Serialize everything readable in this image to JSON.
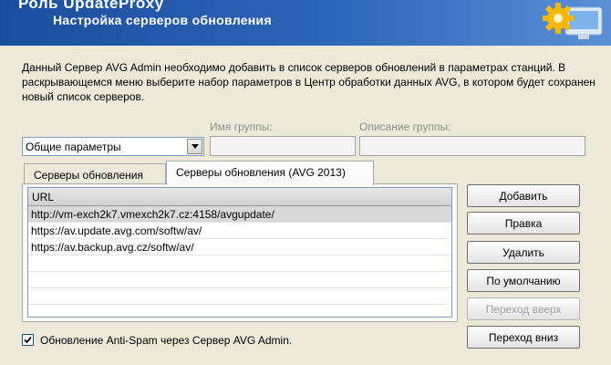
{
  "header": {
    "title": "Роль UpdateProxy",
    "subtitle": "Настройка серверов обновления",
    "logo_icon": "gear-monitor-icon"
  },
  "description": "Данный Сервер AVG Admin необходимо добавить в список серверов обновлений в параметрах станций. В раскрывающемся меню выберите набор параметров в Центр обработки данных AVG, в котором будет сохранен новый список серверов.",
  "group_name_label": "Имя группы:",
  "group_desc_label": "Описание группы:",
  "group_name_value": "",
  "group_desc_value": "",
  "settings_select": {
    "selected": "Общие параметры",
    "icon": "dropdown-arrow-icon"
  },
  "tabs": [
    {
      "label": "Серверы обновления",
      "active": false
    },
    {
      "label": "Серверы обновления (AVG 2013)",
      "active": true
    }
  ],
  "list": {
    "header": "URL",
    "rows": [
      "http://vm-exch2k7.vmexch2k7.cz:4158/avgupdate/",
      "https://av.update.avg.com/softw/av/",
      "https://av.backup.avg.cz/softw/av/"
    ]
  },
  "buttons": {
    "add": "Добавить",
    "edit": "Правка",
    "delete": "Удалить",
    "default": "По умолчанию",
    "move_up": "Переход вверх",
    "move_down": "Переход вниз"
  },
  "antispam_checkbox": {
    "label": "Обновление Anti-Spam через Сервер AVG Admin.",
    "checked": true
  }
}
